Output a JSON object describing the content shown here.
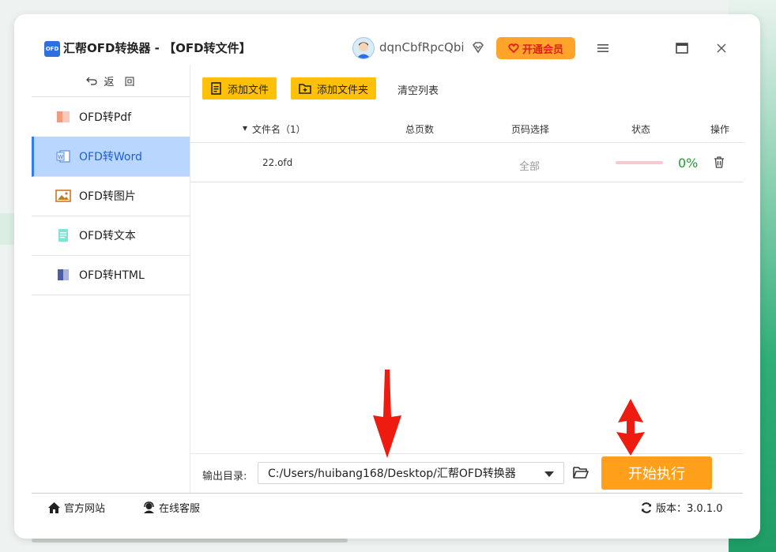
{
  "window": {
    "title": "汇帮OFD转换器 - 【OFD转文件】",
    "logo_text": "OFD",
    "username": "dqnCbfRpcQbi",
    "vip_label": "开通会员"
  },
  "sidebar": {
    "back_label": "返　回",
    "items": [
      {
        "label": "OFD转Pdf",
        "icon": "pdf-icon",
        "active": false
      },
      {
        "label": "OFD转Word",
        "icon": "word-icon",
        "active": true
      },
      {
        "label": "OFD转图片",
        "icon": "image-icon",
        "active": false
      },
      {
        "label": "OFD转文本",
        "icon": "text-icon",
        "active": false
      },
      {
        "label": "OFD转HTML",
        "icon": "html-icon",
        "active": false
      }
    ]
  },
  "toolbar": {
    "add_file": "添加文件",
    "add_folder": "添加文件夹",
    "clear_list": "清空列表"
  },
  "table": {
    "headers": {
      "filename": "文件名（1）",
      "pages": "总页数",
      "page_select": "页码选择",
      "status": "状态",
      "action": "操作"
    },
    "rows": [
      {
        "filename": "22.ofd",
        "pages": "",
        "page_select": "全部",
        "progress": "0%",
        "progress_value": 0
      }
    ]
  },
  "output": {
    "label": "输出目录:",
    "path": "C:/Users/huibang168/Desktop/汇帮OFD转换器"
  },
  "start_button": "开始执行",
  "statusbar": {
    "website": "官方网站",
    "support": "在线客服",
    "version": "版本：3.0.1.0"
  },
  "colors": {
    "accent": "#ffc107",
    "start": "#ff9f1a",
    "active_nav": "#b9d6ff",
    "progress_text": "#1e9e2e",
    "annotation_arrow": "#ee1c10"
  }
}
